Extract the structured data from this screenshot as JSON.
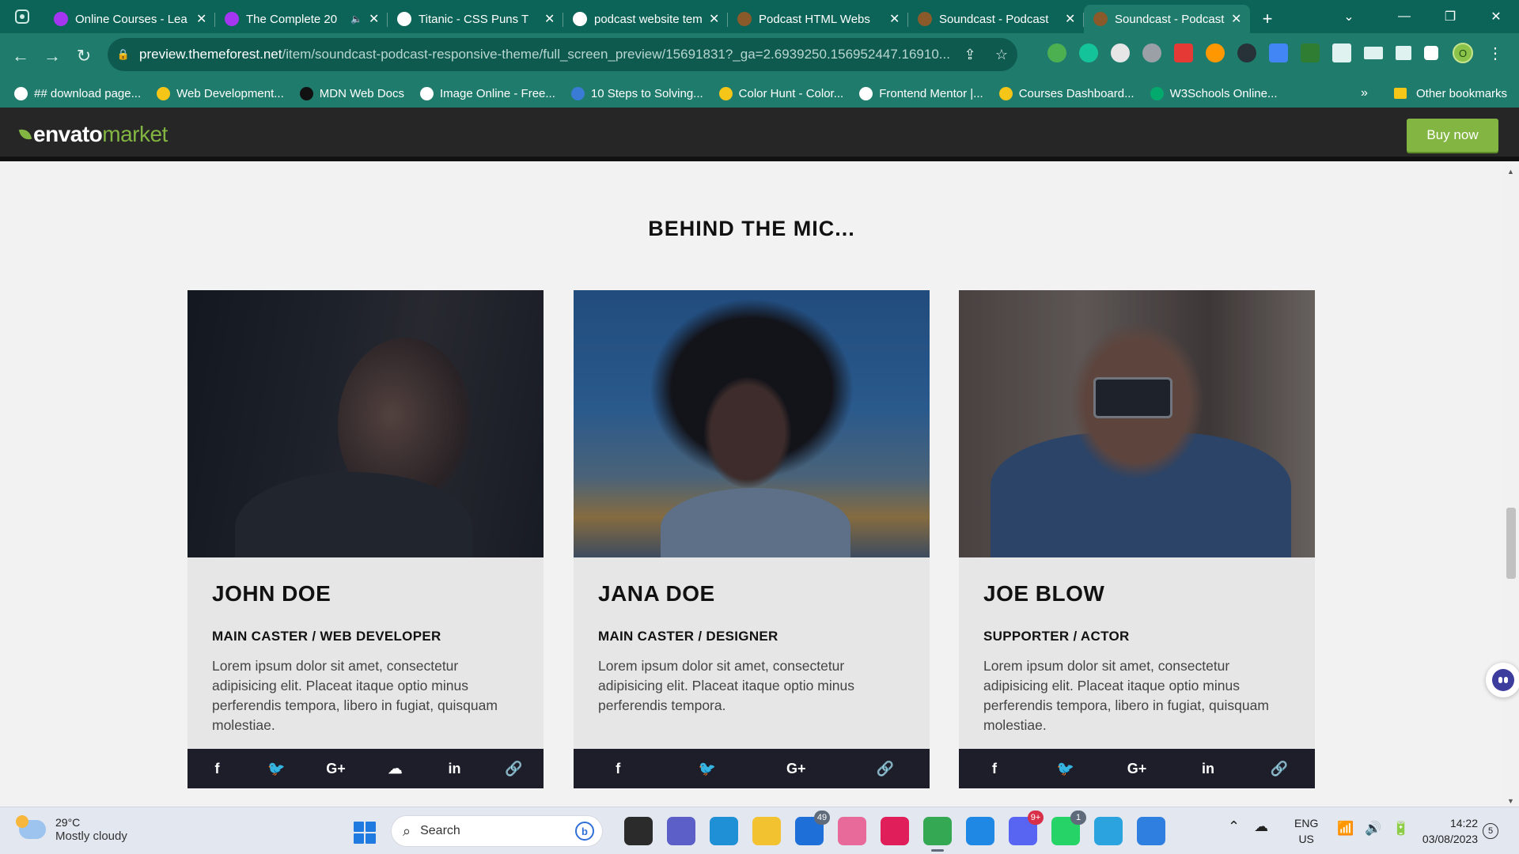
{
  "browser": {
    "tabs": [
      {
        "title": "Online Courses - Lea",
        "favicon": "udemy-icon",
        "color": "#a435f0"
      },
      {
        "title": "The Complete 20",
        "favicon": "udemy-icon",
        "color": "#a435f0",
        "audio": true
      },
      {
        "title": "Titanic - CSS Puns T",
        "favicon": "css-icon",
        "color": "#ffffff"
      },
      {
        "title": "podcast website tem",
        "favicon": "google-icon",
        "color": "#ffffff"
      },
      {
        "title": "Podcast HTML Webs",
        "favicon": "themeforest-icon",
        "color": "#8a5a2a"
      },
      {
        "title": "Soundcast - Podcast",
        "favicon": "themeforest-icon",
        "color": "#8a5a2a"
      },
      {
        "title": "Soundcast - Podcast",
        "favicon": "themeforest-icon",
        "color": "#8a5a2a",
        "active": true
      }
    ],
    "url_host": "preview.themeforest.net",
    "url_path": "/item/soundcast-podcast-responsive-theme/full_screen_preview/15691831?_ga=2.6939250.156952447.16910...",
    "profile_initial": "O",
    "bookmarks": [
      {
        "label": "## download page...",
        "color": "#ffffff"
      },
      {
        "label": "Web Development...",
        "color": "#f5c518"
      },
      {
        "label": "MDN Web Docs",
        "color": "#111111"
      },
      {
        "label": "Image Online - Free...",
        "color": "#ffffff"
      },
      {
        "label": "10 Steps to Solving...",
        "color": "#3a7bd5"
      },
      {
        "label": "Color Hunt - Color...",
        "color": "#f5c518"
      },
      {
        "label": "Frontend Mentor |...",
        "color": "#ffffff"
      },
      {
        "label": "Courses Dashboard...",
        "color": "#f5c518"
      },
      {
        "label": "W3Schools Online...",
        "color": "#04aa6d"
      }
    ],
    "bookmarks_more": "»",
    "other_bookmarks": "Other bookmarks"
  },
  "envato": {
    "logo_part1": "envato",
    "logo_part2": "market",
    "buy_label": "Buy now",
    "accent": "#82b541"
  },
  "page": {
    "section_title": "BEHIND THE MIC...",
    "hosts": [
      {
        "name": "JOHN DOE",
        "role": "MAIN CASTER / WEB DEVELOPER",
        "bio": "Lorem ipsum dolor sit amet, consectetur adipisicing elit. Placeat itaque optio minus perferendis tempora, libero in fugiat, quisquam molestiae.",
        "social": [
          "f",
          "twitter",
          "G+",
          "soundcloud",
          "in",
          "link"
        ]
      },
      {
        "name": "JANA DOE",
        "role": "MAIN CASTER / DESIGNER",
        "bio": "Lorem ipsum dolor sit amet, consectetur adipisicing elit. Placeat itaque optio minus perferendis tempora.",
        "social": [
          "f",
          "twitter",
          "G+",
          "link"
        ]
      },
      {
        "name": "JOE BLOW",
        "role": "SUPPORTER / ACTOR",
        "bio": "Lorem ipsum dolor sit amet, consectetur adipisicing elit. Placeat itaque optio minus perferendis tempora, libero in fugiat, quisquam molestiae.",
        "social": [
          "f",
          "twitter",
          "G+",
          "in",
          "link"
        ]
      }
    ]
  },
  "taskbar": {
    "temp": "29°C",
    "weather": "Mostly cloudy",
    "search_placeholder": "Search",
    "apps": [
      {
        "name": "task-view",
        "color": "#2b2b2b"
      },
      {
        "name": "teams",
        "color": "#5b5fc7"
      },
      {
        "name": "edge",
        "color": "#1f8fd6"
      },
      {
        "name": "file-explorer",
        "color": "#f2c230"
      },
      {
        "name": "mail",
        "color": "#1f6fd8",
        "badge": "49"
      },
      {
        "name": "photos",
        "color": "#e86a9a"
      },
      {
        "name": "slack",
        "color": "#e01e5a"
      },
      {
        "name": "chrome",
        "color": "#34a853",
        "active": true
      },
      {
        "name": "vscode",
        "color": "#1f88e5"
      },
      {
        "name": "discord",
        "color": "#5865f2",
        "badge": "9+",
        "red": true
      },
      {
        "name": "whatsapp",
        "color": "#25d366",
        "badge": "1"
      },
      {
        "name": "telegram",
        "color": "#2aa3df"
      },
      {
        "name": "snipping-tool",
        "color": "#2f7fe0"
      }
    ],
    "lang1": "ENG",
    "lang2": "US",
    "time": "14:22",
    "date": "03/08/2023",
    "notifications": "5"
  }
}
